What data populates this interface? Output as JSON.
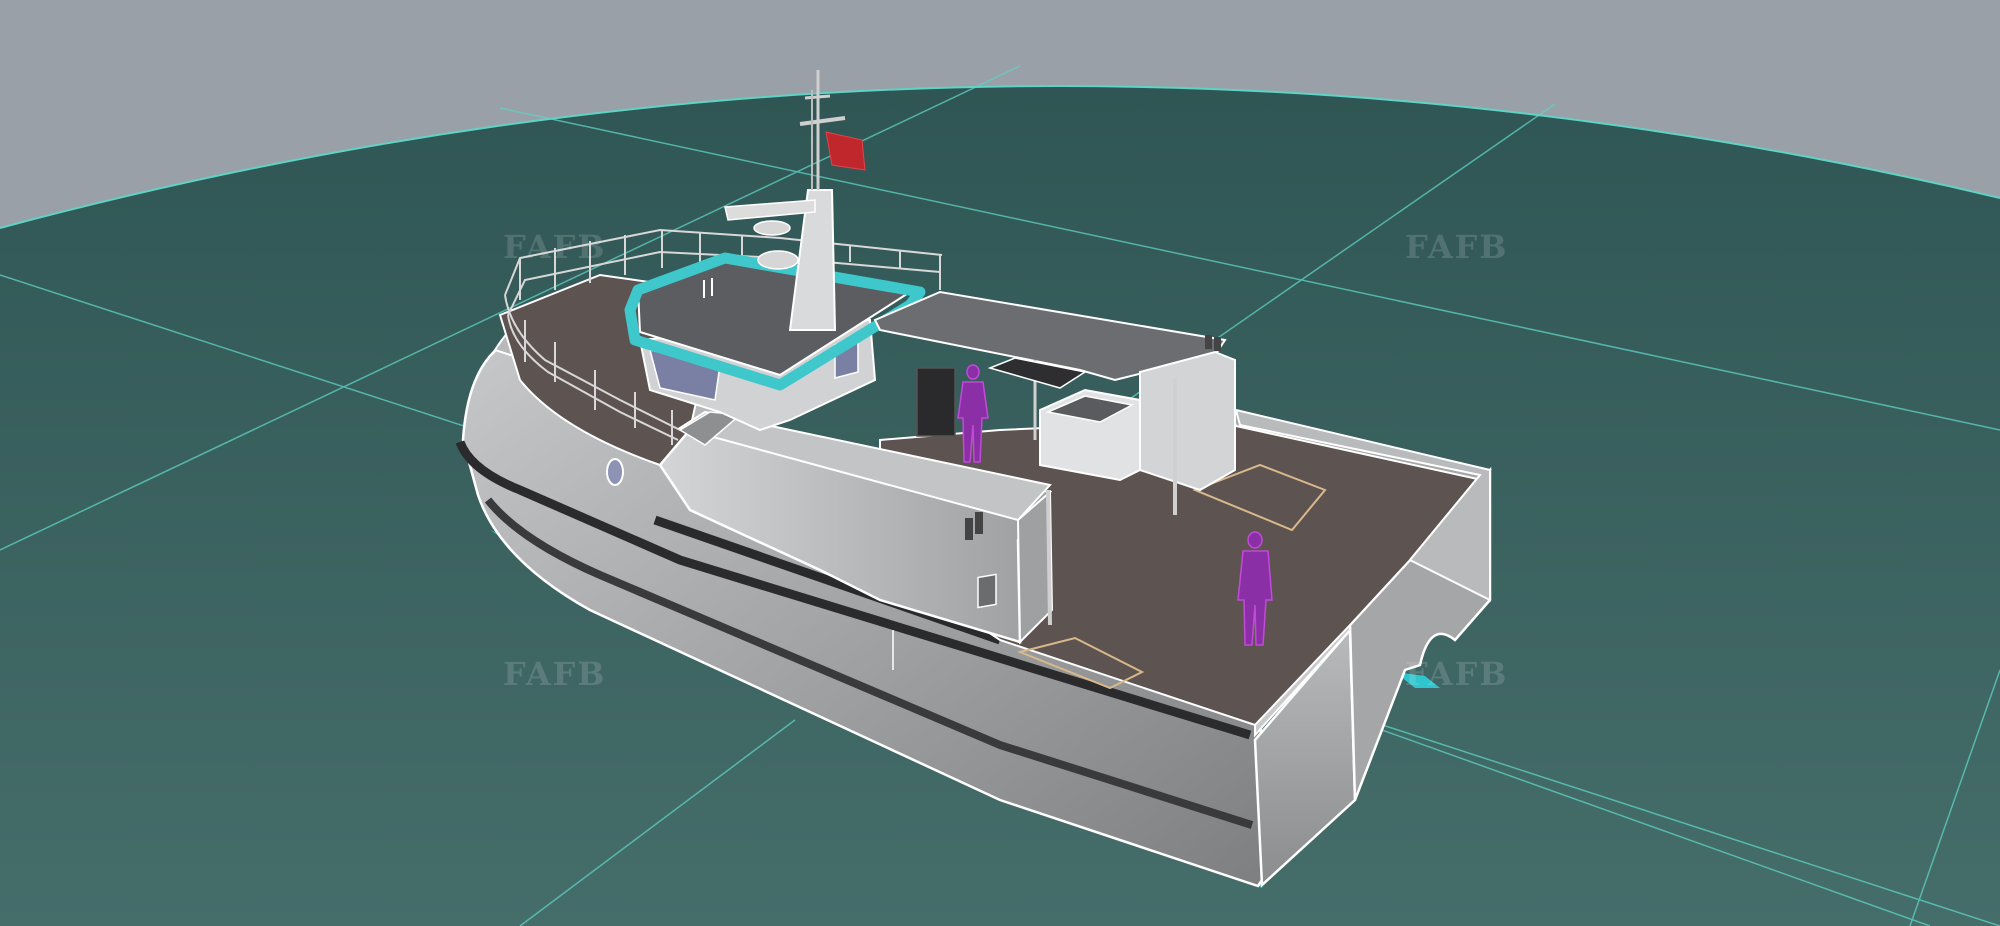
{
  "viewport": {
    "background_color": "#9aa0a8",
    "ground_color": "#3f6663",
    "grid_color": "#5fd3c6",
    "highlight_color": "#3ec8cc",
    "figure_color": "#8a2fa6",
    "flag_color": "#c0272d",
    "hull_color": "#a9aaac",
    "deck_color": "#5d5451"
  },
  "watermarks": [
    "FAFB",
    "FAFB",
    "FAFB",
    "FAFB"
  ],
  "model": {
    "object": "workboat-3d-render",
    "people_count": 2
  }
}
